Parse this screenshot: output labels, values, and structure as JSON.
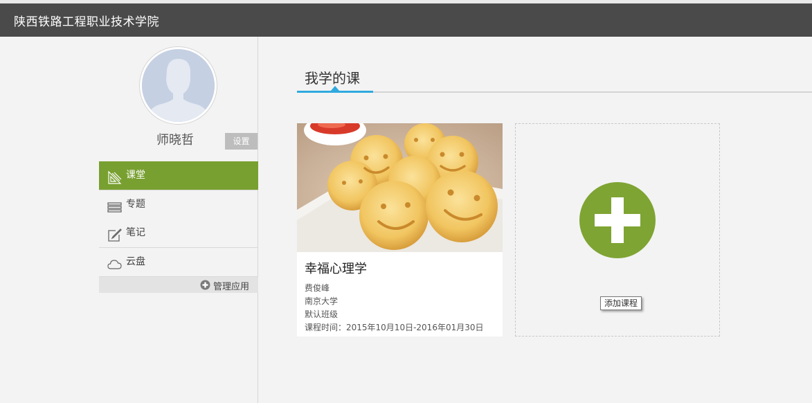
{
  "header": {
    "title": "陕西铁路工程职业技术学院"
  },
  "profile": {
    "name": "师晓哲",
    "settings_label": "设置",
    "avatar_icon": "user-avatar-icon"
  },
  "nav": {
    "items": [
      {
        "label": "课堂",
        "icon": "classroom-icon",
        "active": true
      },
      {
        "label": "专题",
        "icon": "list-icon",
        "active": false
      },
      {
        "label": "笔记",
        "icon": "note-icon",
        "active": false
      },
      {
        "label": "云盘",
        "icon": "cloud-icon",
        "active": false
      }
    ],
    "manage_label": "管理应用",
    "manage_icon": "plus-circle-icon"
  },
  "tabs": {
    "my_courses": "我学的课"
  },
  "course": {
    "name": "幸福心理学",
    "teacher": "费俊峰",
    "school": "南京大学",
    "class_name": "默认班级",
    "time": "课程时间：2015年10月10日-2016年01月30日"
  },
  "add_course": {
    "tooltip": "添加课程",
    "icon": "add-plus-icon"
  },
  "colors": {
    "accent_green": "#78a030",
    "header_bg": "#4a4a4a",
    "tab_blue": "#2fa9df",
    "add_circle": "#7ea433"
  }
}
